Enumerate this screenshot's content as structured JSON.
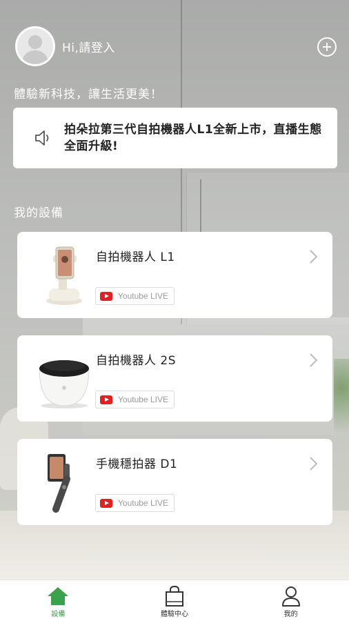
{
  "header": {
    "greeting": "Hi,請登入",
    "avatar_icon": "user-avatar-icon",
    "add_icon": "plus-circle-icon"
  },
  "slogan": "體驗新科技，讓生活更美！",
  "notice": {
    "icon": "speaker-icon",
    "text": "拍朵拉第三代自拍機器人L1全新上市，直播生態全面升級!"
  },
  "section_title": "我的設備",
  "devices": [
    {
      "name": "自拍機器人 L1",
      "badge": "Youtube LIVE",
      "image": "selfie-robot-l1"
    },
    {
      "name": "自拍機器人 2S",
      "badge": "Youtube LIVE",
      "image": "selfie-robot-2s"
    },
    {
      "name": "手機穩拍器 D1",
      "badge": "Youtube LIVE",
      "image": "phone-gimbal-d1"
    }
  ],
  "tabs": [
    {
      "label": "設備",
      "icon": "home-icon",
      "active": true
    },
    {
      "label": "體驗中心",
      "icon": "shopping-bag-icon",
      "active": false
    },
    {
      "label": "我的",
      "icon": "person-icon",
      "active": false
    }
  ],
  "colors": {
    "accent": "#3aa24a",
    "youtube_red": "#e61e1e",
    "card_bg": "#ffffff"
  }
}
